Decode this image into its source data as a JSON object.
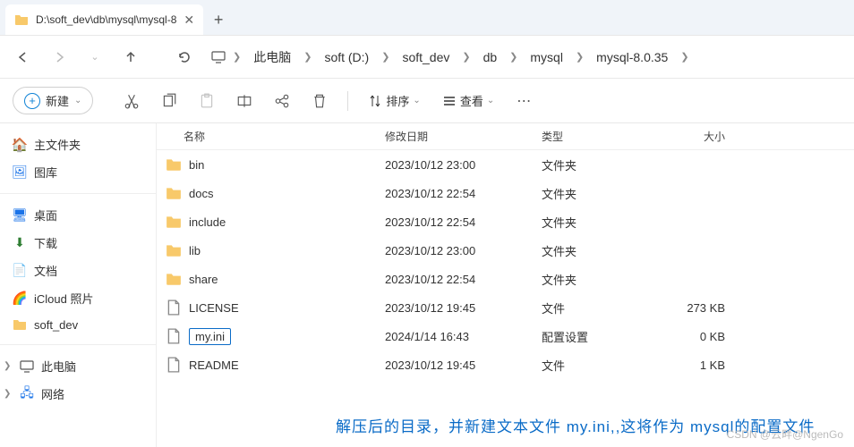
{
  "tab": {
    "title": "D:\\soft_dev\\db\\mysql\\mysql-8"
  },
  "breadcrumbs": [
    "此电脑",
    "soft (D:)",
    "soft_dev",
    "db",
    "mysql",
    "mysql-8.0.35"
  ],
  "toolbar": {
    "new": "新建",
    "sort": "排序",
    "view": "查看"
  },
  "sidebar": {
    "top": [
      {
        "label": "主文件夹",
        "icon": "home"
      },
      {
        "label": "图库",
        "icon": "gallery"
      }
    ],
    "mid": [
      {
        "label": "桌面",
        "icon": "desktop"
      },
      {
        "label": "下载",
        "icon": "download"
      },
      {
        "label": "文档",
        "icon": "document"
      },
      {
        "label": "iCloud 照片",
        "icon": "icloud"
      },
      {
        "label": "soft_dev",
        "icon": "folder"
      }
    ],
    "bottom": [
      {
        "label": "此电脑",
        "icon": "pc"
      },
      {
        "label": "网络",
        "icon": "network"
      }
    ]
  },
  "columns": {
    "name": "名称",
    "date": "修改日期",
    "type": "类型",
    "size": "大小"
  },
  "files": [
    {
      "name": "bin",
      "date": "2023/10/12 23:00",
      "type": "文件夹",
      "size": "",
      "kind": "folder"
    },
    {
      "name": "docs",
      "date": "2023/10/12 22:54",
      "type": "文件夹",
      "size": "",
      "kind": "folder"
    },
    {
      "name": "include",
      "date": "2023/10/12 22:54",
      "type": "文件夹",
      "size": "",
      "kind": "folder"
    },
    {
      "name": "lib",
      "date": "2023/10/12 23:00",
      "type": "文件夹",
      "size": "",
      "kind": "folder"
    },
    {
      "name": "share",
      "date": "2023/10/12 22:54",
      "type": "文件夹",
      "size": "",
      "kind": "folder"
    },
    {
      "name": "LICENSE",
      "date": "2023/10/12 19:45",
      "type": "文件",
      "size": "273 KB",
      "kind": "file"
    },
    {
      "name": "my.ini",
      "date": "2024/1/14 16:43",
      "type": "配置设置",
      "size": "0 KB",
      "kind": "file",
      "selected": true
    },
    {
      "name": "README",
      "date": "2023/10/12 19:45",
      "type": "文件",
      "size": "1 KB",
      "kind": "file"
    }
  ],
  "annotation": "解压后的目录，并新建文本文件  my.ini,,这将作为 mysql的配置文件",
  "watermark": "CSDN @云畔@NgenGo"
}
